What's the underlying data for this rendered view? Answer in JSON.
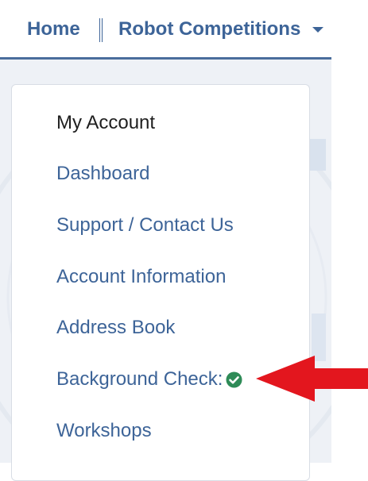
{
  "nav": {
    "home": "Home",
    "competitions": "Robot Competitions"
  },
  "menu": {
    "heading": "My Account",
    "items": [
      {
        "label": "Dashboard"
      },
      {
        "label": "Support / Contact Us"
      },
      {
        "label": "Account Information"
      },
      {
        "label": "Address Book"
      },
      {
        "label": "Background Check:",
        "status_icon": "check-circle-icon",
        "status": "complete"
      },
      {
        "label": "Workshops"
      }
    ]
  },
  "colors": {
    "link": "#3d6498",
    "nav_border": "#4a6d9c",
    "check": "#2e8b57",
    "annotation_arrow": "#e3161e"
  }
}
